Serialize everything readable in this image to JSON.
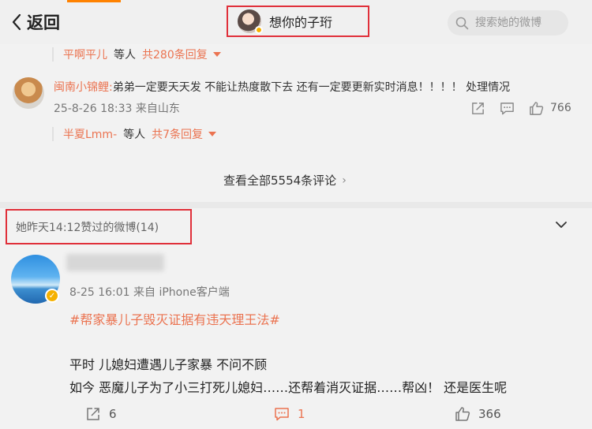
{
  "header": {
    "back_label": "返回",
    "user_name": "想你的子珩",
    "search_placeholder": "搜索她的微博"
  },
  "reply_summaries": [
    {
      "user": "平啊平儿",
      "etc": "等人",
      "count": "共280条回复"
    },
    {
      "user": "半夏Lmm-",
      "etc": "等人",
      "count": "共7条回复"
    }
  ],
  "comment": {
    "user": "闽南小锦鲤:",
    "text": "弟弟一定要天天发 不能让热度散下去 还有一定要更新实时消息！！！！ 处理情况",
    "meta": "25-8-26 18:33 来自山东",
    "likes": "766"
  },
  "view_all": "查看全部5554条评论",
  "liked_header": "她昨天14:12赞过的微博(14)",
  "post": {
    "meta": "8-25 16:01 来自 iPhone客户端",
    "topic": "#帮家暴儿子毁灭证据有违天理王法#",
    "lines": [
      "平时 儿媳妇遭遇儿子家暴  不问不顾",
      "如今  恶魔儿子为了小三打死儿媳妇……还帮着消灭证据……帮凶！  还是医生呢"
    ],
    "reposts": "6",
    "comments": "1",
    "likes": "366"
  },
  "colors": {
    "accent": "#eb7350",
    "highlight_box": "#e0303a",
    "verified": "#f5b100"
  },
  "icons": [
    "chevron-left-icon",
    "search-icon",
    "share-icon",
    "comment-icon",
    "like-icon",
    "chevron-down-icon",
    "chevron-right-icon"
  ]
}
